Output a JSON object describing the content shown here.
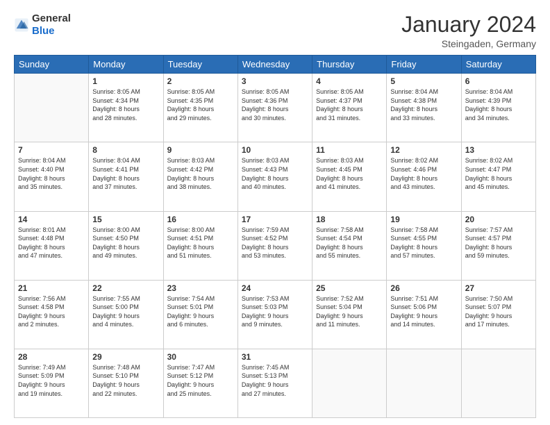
{
  "header": {
    "logo_general": "General",
    "logo_blue": "Blue",
    "month_title": "January 2024",
    "location": "Steingaden, Germany"
  },
  "days_of_week": [
    "Sunday",
    "Monday",
    "Tuesday",
    "Wednesday",
    "Thursday",
    "Friday",
    "Saturday"
  ],
  "weeks": [
    [
      {
        "day": "",
        "info": ""
      },
      {
        "day": "1",
        "info": "Sunrise: 8:05 AM\nSunset: 4:34 PM\nDaylight: 8 hours\nand 28 minutes."
      },
      {
        "day": "2",
        "info": "Sunrise: 8:05 AM\nSunset: 4:35 PM\nDaylight: 8 hours\nand 29 minutes."
      },
      {
        "day": "3",
        "info": "Sunrise: 8:05 AM\nSunset: 4:36 PM\nDaylight: 8 hours\nand 30 minutes."
      },
      {
        "day": "4",
        "info": "Sunrise: 8:05 AM\nSunset: 4:37 PM\nDaylight: 8 hours\nand 31 minutes."
      },
      {
        "day": "5",
        "info": "Sunrise: 8:04 AM\nSunset: 4:38 PM\nDaylight: 8 hours\nand 33 minutes."
      },
      {
        "day": "6",
        "info": "Sunrise: 8:04 AM\nSunset: 4:39 PM\nDaylight: 8 hours\nand 34 minutes."
      }
    ],
    [
      {
        "day": "7",
        "info": "Sunrise: 8:04 AM\nSunset: 4:40 PM\nDaylight: 8 hours\nand 35 minutes."
      },
      {
        "day": "8",
        "info": "Sunrise: 8:04 AM\nSunset: 4:41 PM\nDaylight: 8 hours\nand 37 minutes."
      },
      {
        "day": "9",
        "info": "Sunrise: 8:03 AM\nSunset: 4:42 PM\nDaylight: 8 hours\nand 38 minutes."
      },
      {
        "day": "10",
        "info": "Sunrise: 8:03 AM\nSunset: 4:43 PM\nDaylight: 8 hours\nand 40 minutes."
      },
      {
        "day": "11",
        "info": "Sunrise: 8:03 AM\nSunset: 4:45 PM\nDaylight: 8 hours\nand 41 minutes."
      },
      {
        "day": "12",
        "info": "Sunrise: 8:02 AM\nSunset: 4:46 PM\nDaylight: 8 hours\nand 43 minutes."
      },
      {
        "day": "13",
        "info": "Sunrise: 8:02 AM\nSunset: 4:47 PM\nDaylight: 8 hours\nand 45 minutes."
      }
    ],
    [
      {
        "day": "14",
        "info": "Sunrise: 8:01 AM\nSunset: 4:48 PM\nDaylight: 8 hours\nand 47 minutes."
      },
      {
        "day": "15",
        "info": "Sunrise: 8:00 AM\nSunset: 4:50 PM\nDaylight: 8 hours\nand 49 minutes."
      },
      {
        "day": "16",
        "info": "Sunrise: 8:00 AM\nSunset: 4:51 PM\nDaylight: 8 hours\nand 51 minutes."
      },
      {
        "day": "17",
        "info": "Sunrise: 7:59 AM\nSunset: 4:52 PM\nDaylight: 8 hours\nand 53 minutes."
      },
      {
        "day": "18",
        "info": "Sunrise: 7:58 AM\nSunset: 4:54 PM\nDaylight: 8 hours\nand 55 minutes."
      },
      {
        "day": "19",
        "info": "Sunrise: 7:58 AM\nSunset: 4:55 PM\nDaylight: 8 hours\nand 57 minutes."
      },
      {
        "day": "20",
        "info": "Sunrise: 7:57 AM\nSunset: 4:57 PM\nDaylight: 8 hours\nand 59 minutes."
      }
    ],
    [
      {
        "day": "21",
        "info": "Sunrise: 7:56 AM\nSunset: 4:58 PM\nDaylight: 9 hours\nand 2 minutes."
      },
      {
        "day": "22",
        "info": "Sunrise: 7:55 AM\nSunset: 5:00 PM\nDaylight: 9 hours\nand 4 minutes."
      },
      {
        "day": "23",
        "info": "Sunrise: 7:54 AM\nSunset: 5:01 PM\nDaylight: 9 hours\nand 6 minutes."
      },
      {
        "day": "24",
        "info": "Sunrise: 7:53 AM\nSunset: 5:03 PM\nDaylight: 9 hours\nand 9 minutes."
      },
      {
        "day": "25",
        "info": "Sunrise: 7:52 AM\nSunset: 5:04 PM\nDaylight: 9 hours\nand 11 minutes."
      },
      {
        "day": "26",
        "info": "Sunrise: 7:51 AM\nSunset: 5:06 PM\nDaylight: 9 hours\nand 14 minutes."
      },
      {
        "day": "27",
        "info": "Sunrise: 7:50 AM\nSunset: 5:07 PM\nDaylight: 9 hours\nand 17 minutes."
      }
    ],
    [
      {
        "day": "28",
        "info": "Sunrise: 7:49 AM\nSunset: 5:09 PM\nDaylight: 9 hours\nand 19 minutes."
      },
      {
        "day": "29",
        "info": "Sunrise: 7:48 AM\nSunset: 5:10 PM\nDaylight: 9 hours\nand 22 minutes."
      },
      {
        "day": "30",
        "info": "Sunrise: 7:47 AM\nSunset: 5:12 PM\nDaylight: 9 hours\nand 25 minutes."
      },
      {
        "day": "31",
        "info": "Sunrise: 7:45 AM\nSunset: 5:13 PM\nDaylight: 9 hours\nand 27 minutes."
      },
      {
        "day": "",
        "info": ""
      },
      {
        "day": "",
        "info": ""
      },
      {
        "day": "",
        "info": ""
      }
    ]
  ]
}
